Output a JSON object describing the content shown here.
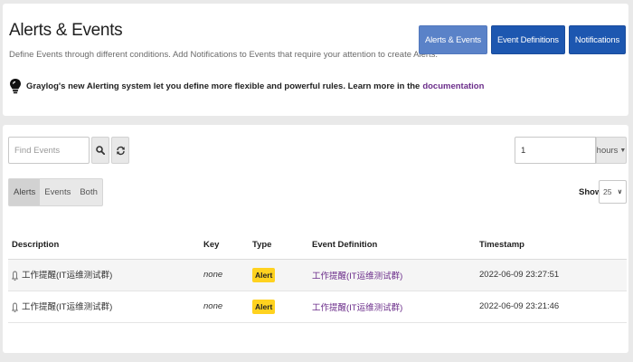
{
  "header": {
    "title": "Alerts & Events",
    "subtitle": "Define Events through different conditions. Add Notifications to Events that require your attention to create Alerts.",
    "info_text": "Graylog's new Alerting system let you define more flexible and powerful rules. Learn more in the",
    "info_link": "documentation",
    "buttons": [
      {
        "label": "Alerts & Events"
      },
      {
        "label": "Event Definitions"
      },
      {
        "label": "Notifications"
      }
    ]
  },
  "toolbar": {
    "search_placeholder": "Find Events",
    "search_icon": "search-icon",
    "refresh_icon": "refresh-icon",
    "range_value": "1",
    "range_unit": "hours",
    "filters": [
      {
        "label": "Alerts",
        "active": true
      },
      {
        "label": "Events",
        "active": false
      },
      {
        "label": "Both",
        "active": false
      }
    ],
    "show_label": "Show",
    "page_size": "25"
  },
  "table": {
    "columns": [
      "Description",
      "Key",
      "Type",
      "Event Definition",
      "Timestamp"
    ],
    "rows": [
      {
        "description": "工作提醒(IT运维测试群)",
        "key": "none",
        "type": "Alert",
        "definition": "工作提醒(IT运维测试群)",
        "timestamp": "2022-06-09 23:27:51"
      },
      {
        "description": "工作提醒(IT运维测试群)",
        "key": "none",
        "type": "Alert",
        "definition": "工作提醒(IT运维测试群)",
        "timestamp": "2022-06-09 23:21:46"
      }
    ]
  },
  "colors": {
    "primary": "#1d57b0",
    "primary_active": "#5a82c8",
    "link": "#6b2d8a",
    "alert_badge": "#ffd21f"
  }
}
